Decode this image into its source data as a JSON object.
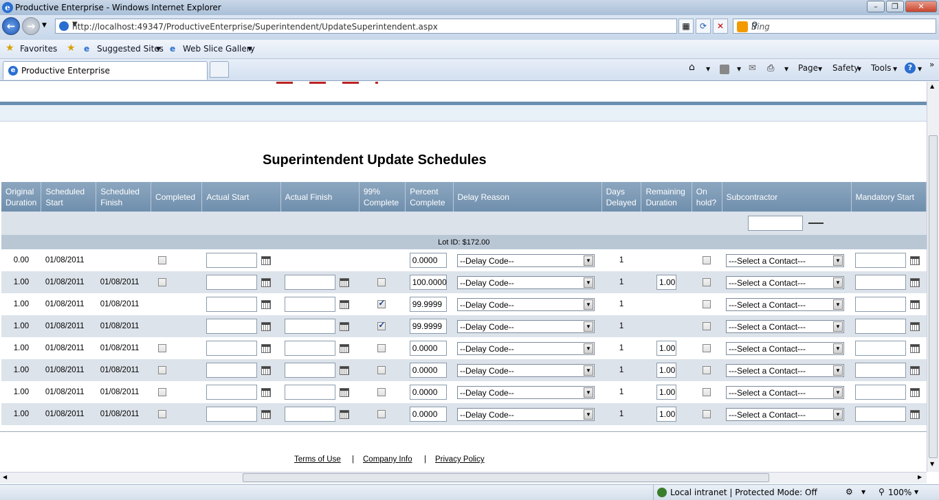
{
  "window": {
    "title": "Productive Enterprise - Windows Internet Explorer"
  },
  "address": {
    "url": "http://localhost:49347/ProductiveEnterprise/Superintendent/UpdateSuperintendent.aspx",
    "search_placeholder": "Bing"
  },
  "favorites": {
    "favorites_label": "Favorites",
    "suggested_sites": "Suggested Sites",
    "web_slice_gallery": "Web Slice Gallery"
  },
  "tabs": [
    {
      "label": "Productive Enterprise"
    }
  ],
  "commandbar": {
    "page": "Page",
    "safety": "Safety",
    "tools": "Tools"
  },
  "page": {
    "title": "Superintendent Update Schedules",
    "group_label": "Lot ID: $172.00"
  },
  "columns": [
    "Original Duration",
    "Scheduled Start",
    "Scheduled Finish",
    "Completed",
    "Actual Start",
    "Actual Finish",
    "99% Complete",
    "Percent Complete",
    "Delay Reason",
    "Days Delayed",
    "Remaining Duration",
    "On hold?",
    "Subcontractor",
    "Mandatory Start"
  ],
  "rows": [
    {
      "orig": "0.00",
      "sstart": "01/08/2011",
      "sfinish": "",
      "completed": "box",
      "afinish": false,
      "c99": "none",
      "percent": "0.0000",
      "delay": "--Delay Code--",
      "days": "1",
      "remaining": "",
      "contact": "---Select a Contact---"
    },
    {
      "orig": "1.00",
      "sstart": "01/08/2011",
      "sfinish": "01/08/2011",
      "completed": "box",
      "afinish": true,
      "c99": "off",
      "percent": "100.0000",
      "delay": "--Delay Code--",
      "days": "1",
      "remaining": "1.00",
      "contact": "---Select a Contact---"
    },
    {
      "orig": "1.00",
      "sstart": "01/08/2011",
      "sfinish": "01/08/2011",
      "completed": "none",
      "afinish": true,
      "c99": "on",
      "percent": "99.9999",
      "delay": "--Delay Code--",
      "days": "1",
      "remaining": "",
      "contact": "---Select a Contact---"
    },
    {
      "orig": "1.00",
      "sstart": "01/08/2011",
      "sfinish": "01/08/2011",
      "completed": "none",
      "afinish": true,
      "c99": "on",
      "percent": "99.9999",
      "delay": "--Delay Code--",
      "days": "1",
      "remaining": "",
      "contact": "---Select a Contact---"
    },
    {
      "orig": "1.00",
      "sstart": "01/08/2011",
      "sfinish": "01/08/2011",
      "completed": "box",
      "afinish": true,
      "c99": "off",
      "percent": "0.0000",
      "delay": "--Delay Code--",
      "days": "1",
      "remaining": "1.00",
      "contact": "---Select a Contact---"
    },
    {
      "orig": "1.00",
      "sstart": "01/08/2011",
      "sfinish": "01/08/2011",
      "completed": "box",
      "afinish": true,
      "c99": "off",
      "percent": "0.0000",
      "delay": "--Delay Code--",
      "days": "1",
      "remaining": "1.00",
      "contact": "---Select a Contact---"
    },
    {
      "orig": "1.00",
      "sstart": "01/08/2011",
      "sfinish": "01/08/2011",
      "completed": "box",
      "afinish": true,
      "c99": "off",
      "percent": "0.0000",
      "delay": "--Delay Code--",
      "days": "1",
      "remaining": "1.00",
      "contact": "---Select a Contact---"
    },
    {
      "orig": "1.00",
      "sstart": "01/08/2011",
      "sfinish": "01/08/2011",
      "completed": "box",
      "afinish": true,
      "c99": "off",
      "percent": "0.0000",
      "delay": "--Delay Code--",
      "days": "1",
      "remaining": "1.00",
      "contact": "---Select a Contact---"
    }
  ],
  "footer": {
    "terms": "Terms of Use",
    "company": "Company Info",
    "privacy": "Privacy Policy"
  },
  "status": {
    "zone": "Local intranet | Protected Mode: Off",
    "zoom": "100%"
  }
}
